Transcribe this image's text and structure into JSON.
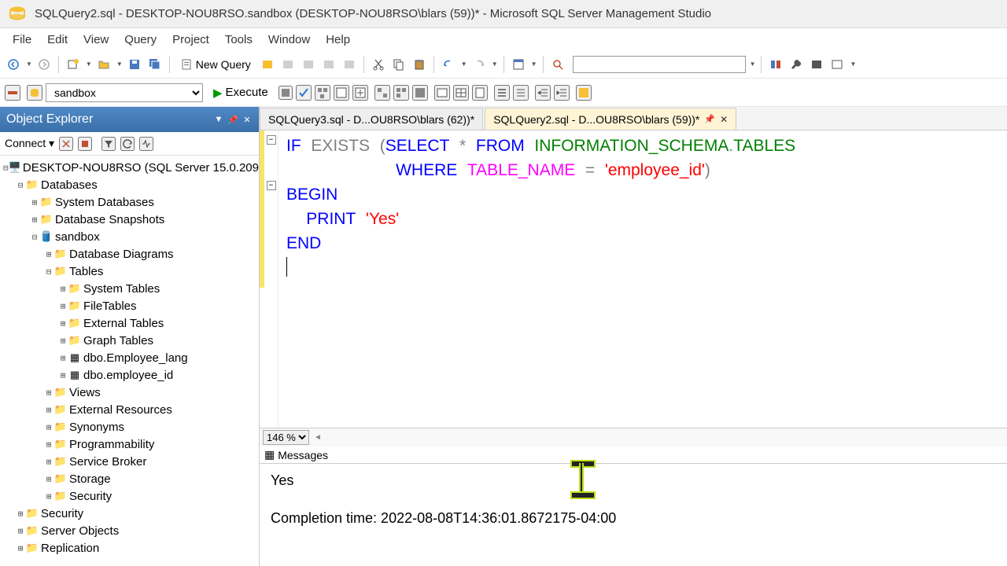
{
  "title": "SQLQuery2.sql - DESKTOP-NOU8RSO.sandbox (DESKTOP-NOU8RSO\\blars (59))* - Microsoft SQL Server Management Studio",
  "menubar": [
    "File",
    "Edit",
    "View",
    "Query",
    "Project",
    "Tools",
    "Window",
    "Help"
  ],
  "toolbar2": {
    "database": "sandbox",
    "execute_label": "Execute"
  },
  "object_explorer": {
    "title": "Object Explorer",
    "connect_label": "Connect",
    "server": "DESKTOP-NOU8RSO (SQL Server 15.0.209",
    "nodes": {
      "databases": "Databases",
      "system_databases": "System Databases",
      "database_snapshots": "Database Snapshots",
      "sandbox": "sandbox",
      "database_diagrams": "Database Diagrams",
      "tables": "Tables",
      "system_tables": "System Tables",
      "filetables": "FileTables",
      "external_tables": "External Tables",
      "graph_tables": "Graph Tables",
      "employee_lang": "dbo.Employee_lang",
      "employee_id": "dbo.employee_id",
      "views": "Views",
      "external_resources": "External Resources",
      "synonyms": "Synonyms",
      "programmability": "Programmability",
      "service_broker": "Service Broker",
      "storage": "Storage",
      "security": "Security",
      "security2": "Security",
      "server_objects": "Server Objects",
      "replication": "Replication"
    }
  },
  "tabs": {
    "tab1": "SQLQuery3.sql - D...OU8RSO\\blars (62))*",
    "tab2": "SQLQuery2.sql - D...OU8RSO\\blars (59))*"
  },
  "code": {
    "if": "IF",
    "exists": "EXISTS",
    "lparen": "(",
    "select": "SELECT",
    "star": "*",
    "from": "FROM",
    "info_schema": "INFORMATION_SCHEMA",
    "dot": ".",
    "tables_kw": "TABLES",
    "where": "WHERE",
    "table_name": "TABLE_NAME",
    "eq": "=",
    "str_employee": "'employee_id'",
    "rparen": ")",
    "begin": "BEGIN",
    "print": "PRINT",
    "str_yes": "'Yes'",
    "end": "END"
  },
  "zoom": "146 %",
  "messages": {
    "label": "Messages",
    "line1": "Yes",
    "line2": "Completion time: 2022-08-08T14:36:01.8672175-04:00"
  }
}
